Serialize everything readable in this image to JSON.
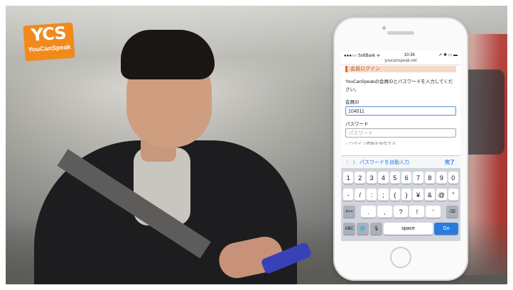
{
  "logo": {
    "main": "YCS",
    "sub": "YouCanSpeak"
  },
  "phone": {
    "status": {
      "carrier": "●●●○○ SoftBank ᯤ",
      "time": "10:36",
      "icons": "➚ ✱ ▭ ▬"
    },
    "url": "youcanspeak.net",
    "page": {
      "heading": "会員ログイン",
      "description": "YouCanSpeakの会員IDとパスワードを入力してください。",
      "id_label": "会員ID",
      "id_value": "104011",
      "password_label": "パスワード",
      "password_placeholder": "パスワード",
      "cutoff_text": "○ ログイン情報を保存する"
    },
    "accessory": {
      "prev": "〈",
      "next": "〉",
      "autofill": "パスワードを自動入力",
      "done": "完了"
    },
    "keyboard": {
      "row1": [
        "1",
        "2",
        "3",
        "4",
        "5",
        "6",
        "7",
        "8",
        "9",
        "0"
      ],
      "row2": [
        "-",
        "/",
        ":",
        ";",
        "(",
        ")",
        "¥",
        "&",
        "@",
        "\""
      ],
      "row3_mod": "#+=",
      "row3": [
        ".",
        ",",
        "?",
        "!",
        "'"
      ],
      "row3_del": "⌫",
      "row4": {
        "abc": "ABC",
        "globe": "🌐",
        "mic": "🎙",
        "space": "space",
        "go": "Go"
      }
    }
  }
}
